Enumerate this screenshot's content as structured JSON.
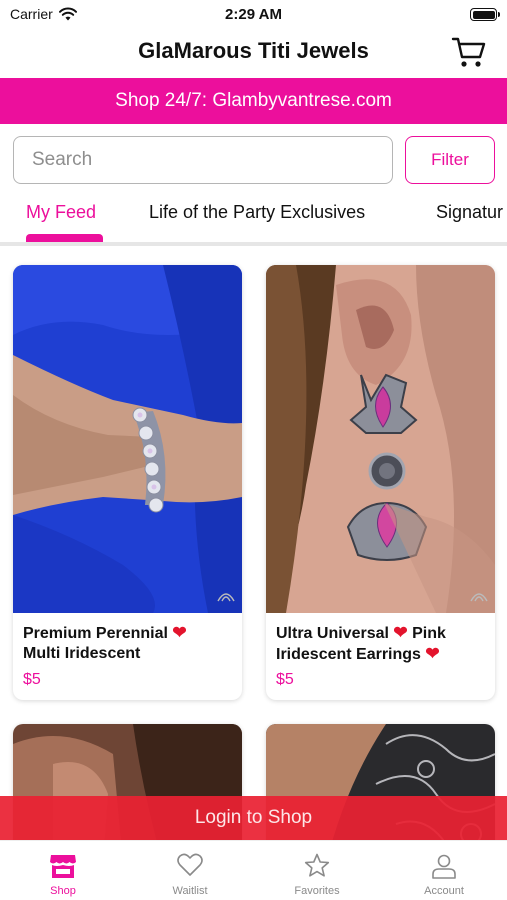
{
  "status_bar": {
    "carrier": "Carrier",
    "time": "2:29 AM"
  },
  "header": {
    "title": "GlaMarous Titi Jewels"
  },
  "banner": {
    "text": "Shop 24/7: Glambyvantrese.com"
  },
  "search": {
    "placeholder": "Search",
    "value": ""
  },
  "filter": {
    "label": "Filter"
  },
  "tabs": [
    {
      "label": "My Feed",
      "active": true
    },
    {
      "label": "Life of  the Party Exclusives",
      "active": false
    },
    {
      "label": "Signatur",
      "active": false
    }
  ],
  "products": [
    {
      "name": "Premium Perennial",
      "name_line2": "Multi Iridescent",
      "price": "$5"
    },
    {
      "name": "Ultra Universal",
      "name_mid": "Pink",
      "name_line2": "Iridescent Earrings",
      "price": "$5"
    }
  ],
  "login_bar": {
    "label": "Login to Shop"
  },
  "bottom_nav": [
    {
      "label": "Shop",
      "icon": "store-icon",
      "active": true
    },
    {
      "label": "Waitlist",
      "icon": "heart-outline-icon",
      "active": false
    },
    {
      "label": "Favorites",
      "icon": "star-outline-icon",
      "active": false
    },
    {
      "label": "Account",
      "icon": "person-icon",
      "active": false
    }
  ],
  "colors": {
    "accent": "#ec0f9c",
    "login_bar": "#e92133",
    "heart": "#e3142d"
  }
}
